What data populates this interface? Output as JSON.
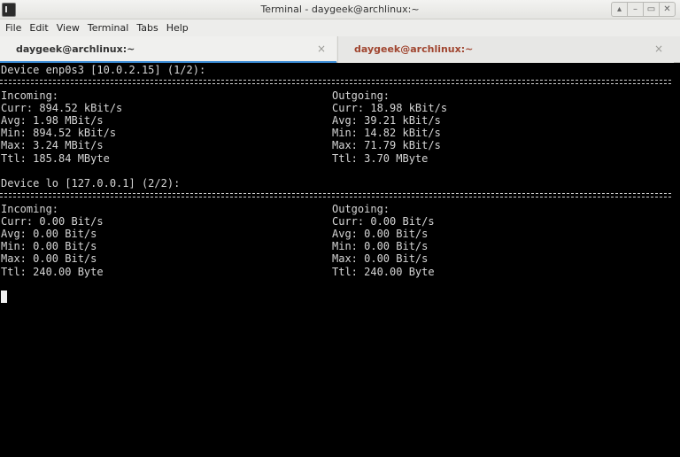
{
  "window": {
    "title": "Terminal - daygeek@archlinux:~",
    "buttons": {
      "minimize": "▴",
      "restore": "▭",
      "close": "✕",
      "shade": "–"
    }
  },
  "menubar": {
    "items": [
      "File",
      "Edit",
      "View",
      "Terminal",
      "Tabs",
      "Help"
    ]
  },
  "tabs": [
    {
      "label": "daygeek@archlinux:~",
      "active": true,
      "close": "×"
    },
    {
      "label": "daygeek@archlinux:~",
      "active": false,
      "close": "×"
    }
  ],
  "devices": [
    {
      "header": "Device enp0s3 [10.0.2.15] (1/2):",
      "incoming": {
        "title": "Incoming:",
        "lines": [
          "Curr: 894.52 kBit/s",
          "Avg: 1.98 MBit/s",
          "Min: 894.52 kBit/s",
          "Max: 3.24 MBit/s",
          "Ttl: 185.84 MByte"
        ]
      },
      "outgoing": {
        "title": "Outgoing:",
        "lines": [
          "Curr: 18.98 kBit/s",
          "Avg: 39.21 kBit/s",
          "Min: 14.82 kBit/s",
          "Max: 71.79 kBit/s",
          "Ttl: 3.70 MByte"
        ]
      }
    },
    {
      "header": "Device lo [127.0.0.1] (2/2):",
      "incoming": {
        "title": "Incoming:",
        "lines": [
          "Curr: 0.00 Bit/s",
          "Avg: 0.00 Bit/s",
          "Min: 0.00 Bit/s",
          "Max: 0.00 Bit/s",
          "Ttl: 240.00 Byte"
        ]
      },
      "outgoing": {
        "title": "Outgoing:",
        "lines": [
          "Curr: 0.00 Bit/s",
          "Avg: 0.00 Bit/s",
          "Min: 0.00 Bit/s",
          "Max: 0.00 Bit/s",
          "Ttl: 240.00 Byte"
        ]
      }
    }
  ]
}
